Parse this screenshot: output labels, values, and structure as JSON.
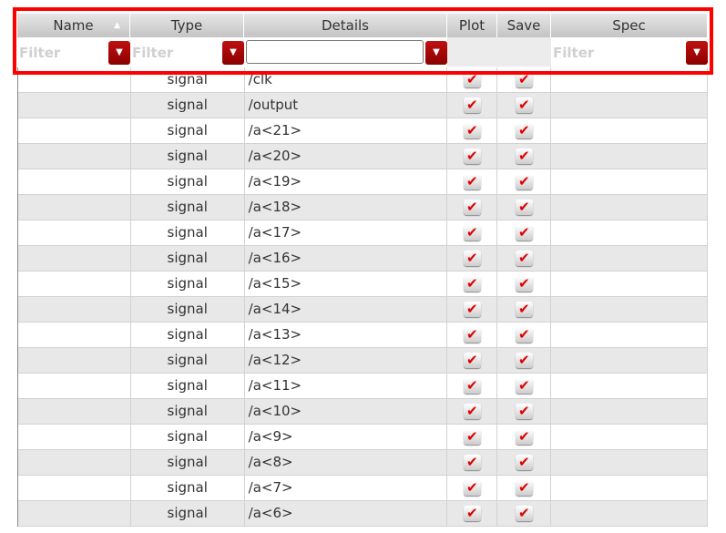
{
  "columns": {
    "name": "Name",
    "type": "Type",
    "details": "Details",
    "plot": "Plot",
    "save": "Save",
    "spec": "Spec"
  },
  "sort": {
    "column": "Name",
    "direction": "ascending",
    "icon": "sort-up-icon"
  },
  "filters": {
    "name_placeholder": "Filter",
    "type_placeholder": "Filter",
    "details_value": "",
    "spec_placeholder": "Filter"
  },
  "highlight_color": "#ff0000",
  "rows": [
    {
      "type": "signal",
      "details": "/clk",
      "plot": true,
      "save": true
    },
    {
      "type": "signal",
      "details": "/output",
      "plot": true,
      "save": true
    },
    {
      "type": "signal",
      "details": "/a<21>",
      "plot": true,
      "save": true
    },
    {
      "type": "signal",
      "details": "/a<20>",
      "plot": true,
      "save": true
    },
    {
      "type": "signal",
      "details": "/a<19>",
      "plot": true,
      "save": true
    },
    {
      "type": "signal",
      "details": "/a<18>",
      "plot": true,
      "save": true
    },
    {
      "type": "signal",
      "details": "/a<17>",
      "plot": true,
      "save": true
    },
    {
      "type": "signal",
      "details": "/a<16>",
      "plot": true,
      "save": true
    },
    {
      "type": "signal",
      "details": "/a<15>",
      "plot": true,
      "save": true
    },
    {
      "type": "signal",
      "details": "/a<14>",
      "plot": true,
      "save": true
    },
    {
      "type": "signal",
      "details": "/a<13>",
      "plot": true,
      "save": true
    },
    {
      "type": "signal",
      "details": "/a<12>",
      "plot": true,
      "save": true
    },
    {
      "type": "signal",
      "details": "/a<11>",
      "plot": true,
      "save": true
    },
    {
      "type": "signal",
      "details": "/a<10>",
      "plot": true,
      "save": true
    },
    {
      "type": "signal",
      "details": "/a<9>",
      "plot": true,
      "save": true
    },
    {
      "type": "signal",
      "details": "/a<8>",
      "plot": true,
      "save": true
    },
    {
      "type": "signal",
      "details": "/a<7>",
      "plot": true,
      "save": true
    },
    {
      "type": "signal",
      "details": "/a<6>",
      "plot": true,
      "save": true
    }
  ]
}
